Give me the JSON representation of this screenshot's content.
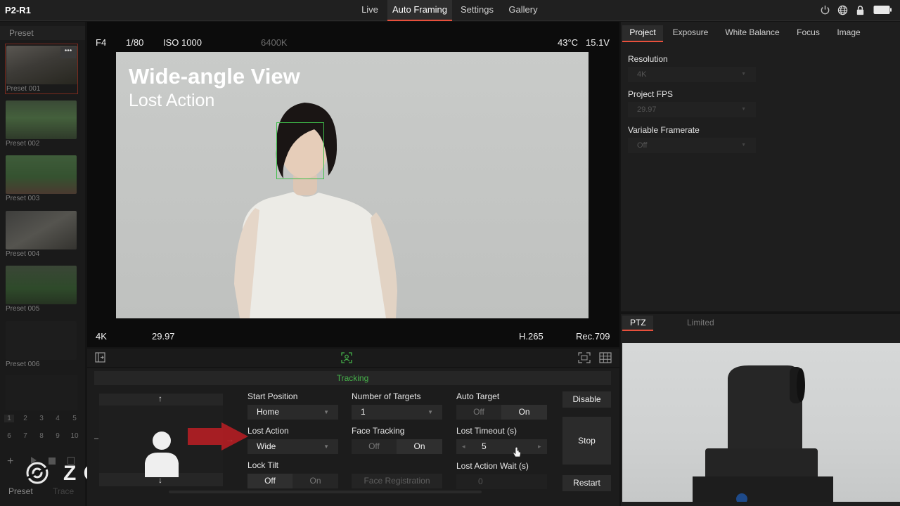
{
  "app": {
    "title": "P2-R1"
  },
  "nav": {
    "tabs": [
      "Live",
      "Auto Framing",
      "Settings",
      "Gallery"
    ],
    "active": "Auto Framing"
  },
  "topicons": [
    "power-icon",
    "globe-icon",
    "lock-icon",
    "battery-icon"
  ],
  "presets": {
    "header": "Preset",
    "items": [
      "Preset 001",
      "Preset 002",
      "Preset 003",
      "Preset 004",
      "Preset 005",
      "Preset 006"
    ],
    "grid": [
      "1",
      "2",
      "3",
      "4",
      "5",
      "6",
      "7",
      "8",
      "9",
      "10"
    ],
    "footer_tabs": [
      "Preset",
      "Trace"
    ]
  },
  "brand": "Z CAM",
  "viewer": {
    "hud_top": {
      "aperture": "F4",
      "shutter": "1/80",
      "iso": "ISO 1000",
      "wb": "6400K",
      "temp": "43°C",
      "voltage": "15.1V"
    },
    "hud_bottom": {
      "resolution": "4K",
      "fps": "29.97",
      "codec": "H.265",
      "gamut": "Rec.709"
    },
    "overlay_title": "Wide-angle View",
    "overlay_subtitle": "Lost Action"
  },
  "tracking": {
    "header": "Tracking",
    "start_position": {
      "label": "Start Position",
      "value": "Home"
    },
    "number_of_targets": {
      "label": "Number of Targets",
      "value": "1"
    },
    "auto_target": {
      "label": "Auto Target",
      "off": "Off",
      "on": "On",
      "selected": "On"
    },
    "lost_action": {
      "label": "Lost Action",
      "value": "Wide"
    },
    "face_tracking": {
      "label": "Face Tracking",
      "off": "Off",
      "on": "On",
      "selected": "On"
    },
    "lost_timeout": {
      "label": "Lost Timeout (s)",
      "value": "5"
    },
    "lock_tilt": {
      "label": "Lock Tilt",
      "off": "Off",
      "on": "On",
      "selected": "Off"
    },
    "face_registration": {
      "label": "Face Registration"
    },
    "lost_action_wait": {
      "label": "Lost Action Wait (s)",
      "value": "0"
    },
    "buttons": {
      "disable": "Disable",
      "stop": "Stop",
      "restart": "Restart"
    }
  },
  "settings": {
    "tabs": [
      "Project",
      "Exposure",
      "White Balance",
      "Focus",
      "Image"
    ],
    "active": "Project",
    "resolution": {
      "label": "Resolution",
      "value": "4K"
    },
    "project_fps": {
      "label": "Project FPS",
      "value": "29.97"
    },
    "variable_framerate": {
      "label": "Variable Framerate",
      "value": "Off"
    }
  },
  "ptz": {
    "tabs": [
      "PTZ",
      "Limited"
    ],
    "active": "PTZ"
  },
  "colors": {
    "accent": "#e8503c",
    "tracking_green": "#45b04a",
    "face_box": "#3fbf4a"
  }
}
